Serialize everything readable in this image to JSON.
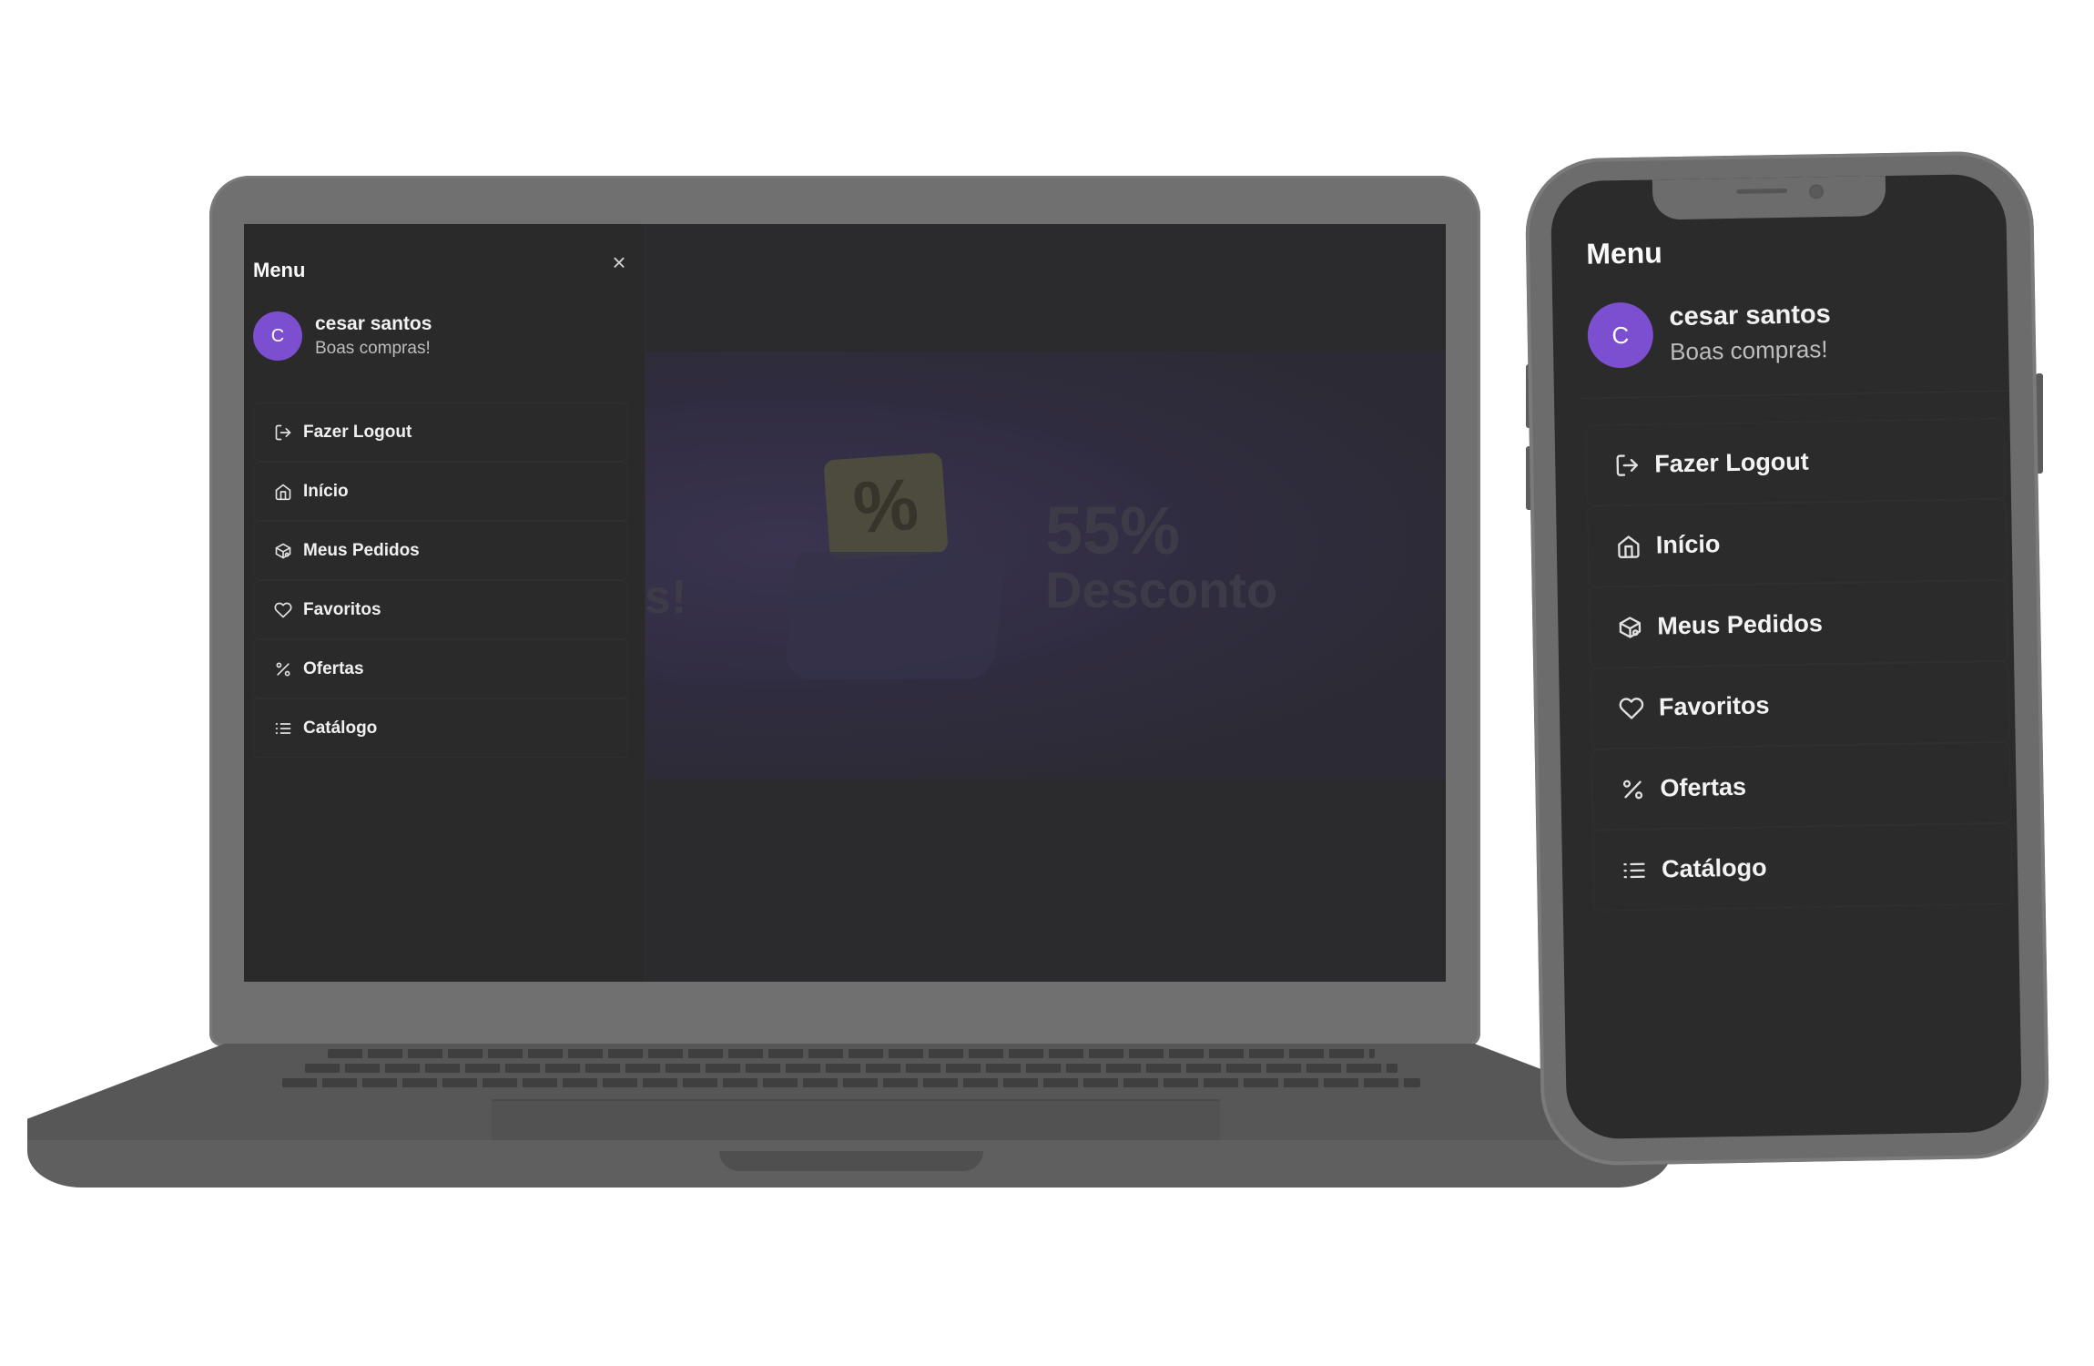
{
  "laptop": {
    "drawer": {
      "title": "Menu",
      "close_icon": "close-icon",
      "user": {
        "initial": "C",
        "name": "cesar santos",
        "greeting": "Boas compras!"
      },
      "items": [
        {
          "label": "Fazer Logout",
          "icon": "logout-icon"
        },
        {
          "label": "Início",
          "icon": "home-icon"
        },
        {
          "label": "Meus Pedidos",
          "icon": "package-icon"
        },
        {
          "label": "Favoritos",
          "icon": "heart-icon"
        },
        {
          "label": "Ofertas",
          "icon": "percent-icon"
        },
        {
          "label": "Catálogo",
          "icon": "list-icon"
        }
      ]
    },
    "background": {
      "promo_big": "55%",
      "promo_word": "Desconto"
    }
  },
  "phone": {
    "title": "Menu",
    "user": {
      "initial": "C",
      "name": "cesar santos",
      "greeting": "Boas compras!"
    },
    "items": [
      {
        "label": "Fazer Logout",
        "icon": "logout-icon"
      },
      {
        "label": "Início",
        "icon": "home-icon"
      },
      {
        "label": "Meus Pedidos",
        "icon": "package-icon"
      },
      {
        "label": "Favoritos",
        "icon": "heart-icon"
      },
      {
        "label": "Ofertas",
        "icon": "percent-icon"
      },
      {
        "label": "Catálogo",
        "icon": "list-icon"
      }
    ]
  },
  "colors": {
    "accent": "#7c4fd0",
    "background": "#2a2a2a",
    "text": "#f0f0f0",
    "muted": "#bdbdbd"
  }
}
